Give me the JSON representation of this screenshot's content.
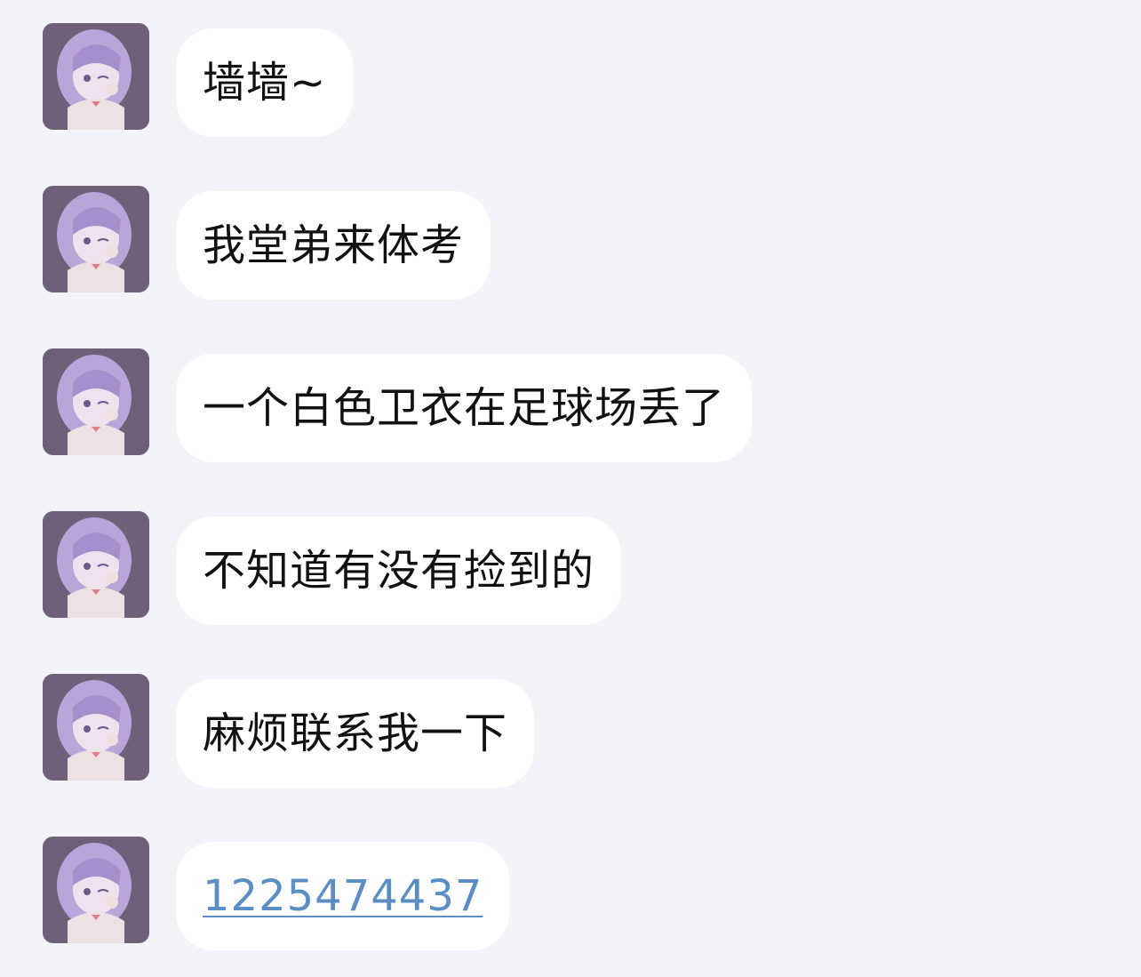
{
  "conversation": {
    "messages": [
      {
        "text": "墙墙~",
        "type": "text"
      },
      {
        "text": "我堂弟来体考",
        "type": "text"
      },
      {
        "text": "一个白色卫衣在足球场丢了",
        "type": "text"
      },
      {
        "text": "不知道有没有捡到的",
        "type": "text"
      },
      {
        "text": "麻烦联系我一下",
        "type": "text"
      },
      {
        "text": "1225474437",
        "type": "phone-link"
      }
    ]
  },
  "colors": {
    "background": "#f3f4f9",
    "bubble": "#ffffff",
    "text": "#111111",
    "link": "#5b8ec5",
    "avatar_hair": "#b7a2d6",
    "avatar_bg": "#6f6079"
  }
}
